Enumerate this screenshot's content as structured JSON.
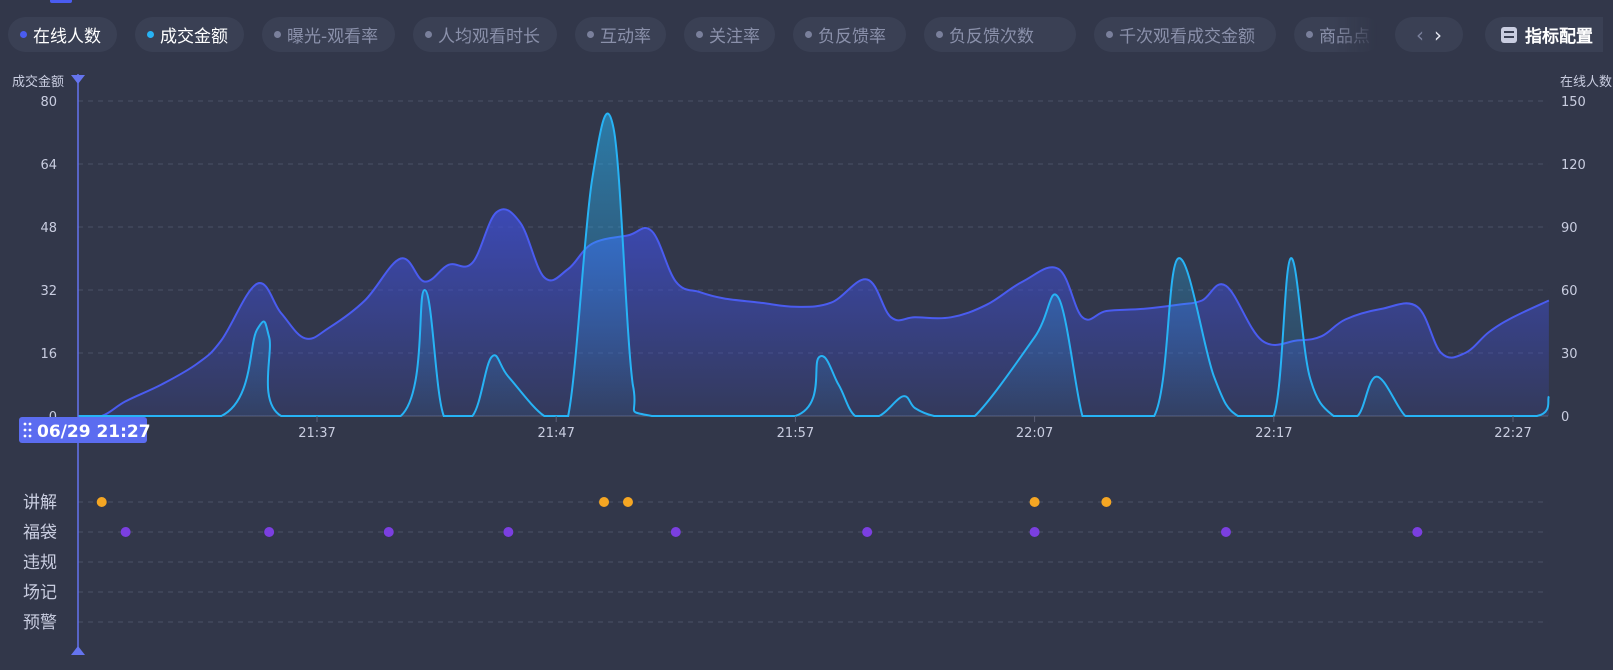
{
  "tabs": [
    {
      "label": "在线人数",
      "active": true,
      "dot_color": "#4a5cf0"
    },
    {
      "label": "成交金额",
      "active": true,
      "dot_color": "#27b3f5"
    },
    {
      "label": "曝光-观看率",
      "active": false
    },
    {
      "label": "人均观看时长",
      "active": false
    },
    {
      "label": "互动率",
      "active": false
    },
    {
      "label": "关注率",
      "active": false
    },
    {
      "label": "负反馈率",
      "active": false
    },
    {
      "label": "负反馈次数",
      "active": false
    },
    {
      "label": "千次观看成交金额",
      "active": false
    },
    {
      "label": "商品点",
      "active": false
    }
  ],
  "nav": {
    "prev_icon": "chevron-left-icon",
    "next_icon": "chevron-right-icon"
  },
  "config_button": {
    "label": "指标配置",
    "icon": "settings-sliders-icon"
  },
  "cursor": {
    "time_label": "06/29 21:27",
    "handle_icon": "drag-handle-icon"
  },
  "colors": {
    "online": "#4a5cf0",
    "gmv": "#27b3f5",
    "explain": "#f5a623",
    "lucky_bag": "#7b3fe0"
  },
  "chart_data": {
    "type": "area",
    "x_ticks": [
      "21:37",
      "21:47",
      "21:57",
      "22:07",
      "22:17",
      "22:27"
    ],
    "x_domain": [
      0,
      61.5
    ],
    "left_axis": {
      "label": "成交金额",
      "ticks": [
        0,
        16,
        32,
        48,
        64,
        80
      ],
      "range": [
        0,
        80
      ]
    },
    "right_axis": {
      "label": "在线人数",
      "ticks": [
        0,
        30,
        60,
        90,
        120,
        150
      ],
      "range": [
        0,
        150
      ]
    },
    "grid": true,
    "series": [
      {
        "axis": "right",
        "x": [
          0,
          1,
          2,
          3.5,
          5,
          6,
          7.5,
          8.5,
          9.5,
          10.5,
          12,
          13.5,
          14.5,
          15.5,
          16.5,
          17.5,
          18.5,
          19.5,
          20.5,
          21.5,
          23,
          24,
          25,
          26,
          27,
          28.5,
          30,
          31.5,
          33,
          34,
          35,
          36.5,
          38,
          39.5,
          41,
          42,
          43,
          44.5,
          46,
          47,
          48,
          49.5,
          51,
          52,
          53,
          54.5,
          56,
          57,
          58,
          59,
          60,
          61.5
        ],
        "values": [
          0,
          0,
          7,
          15,
          25,
          36,
          63,
          49,
          37,
          42,
          55,
          75,
          64,
          72,
          73,
          97,
          92,
          66,
          70,
          82,
          86,
          88,
          64,
          59,
          56,
          54,
          52,
          54,
          65,
          47,
          47,
          47,
          53,
          64,
          70,
          47,
          50,
          51,
          53,
          55,
          62,
          36,
          36,
          38,
          46,
          51,
          52,
          30,
          30,
          40,
          47,
          55
        ]
      },
      {
        "axis": "left",
        "x": [
          0,
          6,
          7.5,
          8,
          8.5,
          13.5,
          14.5,
          15.3,
          16.5,
          17.3,
          18,
          19.5,
          20.5,
          21.5,
          22.4,
          23.2,
          24,
          30,
          31,
          31.8,
          32.5,
          33.5,
          34.5,
          35,
          35.8,
          36.5,
          37.5,
          40,
          41,
          42,
          42.5,
          45,
          46,
          47.5,
          48.5,
          50,
          50.7,
          51.5,
          52.5,
          53.5,
          54.3,
          55.5,
          56.2,
          57,
          57.8,
          61,
          61.5
        ],
        "values": [
          0,
          0,
          22,
          20,
          0,
          0,
          32,
          0,
          0,
          15,
          10,
          0,
          0,
          60,
          73,
          8,
          0,
          0,
          15,
          8,
          0,
          0,
          5,
          2,
          0,
          0,
          0,
          20,
          30,
          0,
          0,
          0,
          40,
          10,
          0,
          0,
          40,
          10,
          0,
          0,
          10,
          0,
          0,
          0,
          0,
          0,
          5
        ]
      }
    ],
    "event_rows": [
      {
        "label": "讲解",
        "times": [
          1,
          22,
          23,
          40,
          43
        ]
      },
      {
        "label": "福袋",
        "times": [
          2,
          8,
          13,
          18,
          25,
          33,
          40,
          48,
          56
        ]
      },
      {
        "label": "违规",
        "times": []
      },
      {
        "label": "场记",
        "times": []
      },
      {
        "label": "预警",
        "times": []
      }
    ]
  }
}
